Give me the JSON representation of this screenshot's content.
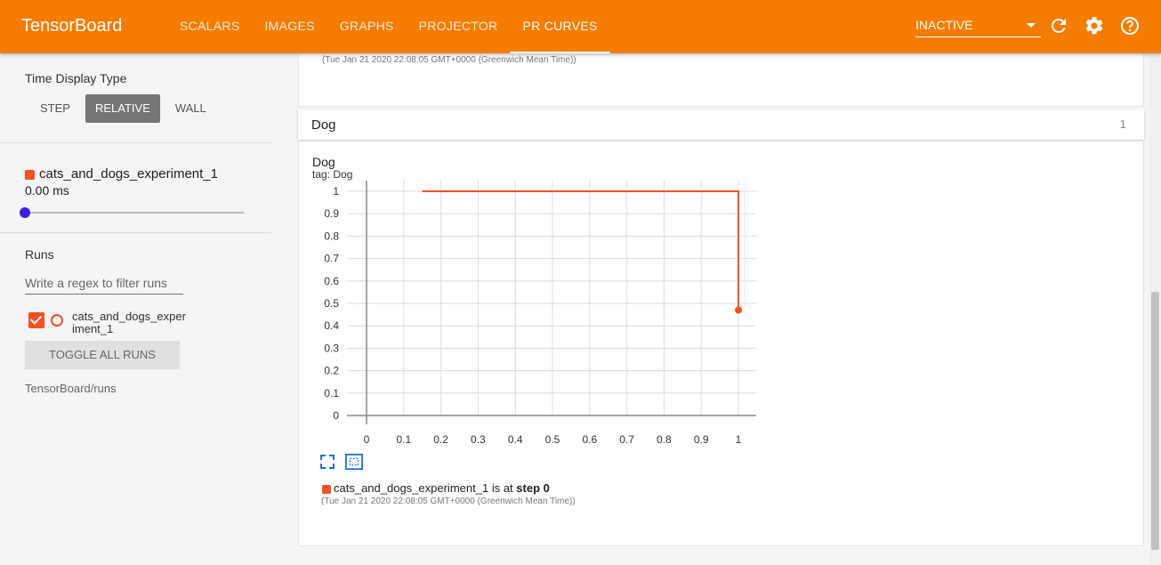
{
  "header": {
    "brand": "TensorBoard",
    "tabs": [
      {
        "label": "SCALARS",
        "active": false
      },
      {
        "label": "IMAGES",
        "active": false
      },
      {
        "label": "GRAPHS",
        "active": false
      },
      {
        "label": "PROJECTOR",
        "active": false
      },
      {
        "label": "PR CURVES",
        "active": true
      }
    ],
    "plugin_select": "INACTIVE",
    "icons": [
      "refresh-icon",
      "settings-icon",
      "help-icon"
    ],
    "color": "#f57c00"
  },
  "sidebar": {
    "time_display": {
      "title": "Time Display Type",
      "options": [
        "STEP",
        "RELATIVE",
        "WALL"
      ],
      "selected": "RELATIVE"
    },
    "step_slider": {
      "run": "cats_and_dogs_experiment_1",
      "value": "0.00 ms",
      "run_color": "#f4511e"
    },
    "runs": {
      "title": "Runs",
      "filter_placeholder": "Write a regex to filter runs",
      "items": [
        {
          "name": "cats_and_dogs_experiment_1",
          "checked": true
        }
      ],
      "toggle_all": "TOGGLE ALL RUNS",
      "logdir": "TensorBoard/runs"
    }
  },
  "main": {
    "prev_timestamp": "(Tue Jan 21 2020 22:08:05 GMT+0000 (Greenwich Mean Time))",
    "category": {
      "name": "Dog",
      "count": "1"
    },
    "card": {
      "title": "Dog",
      "tag": "tag: Dog",
      "legend": {
        "run": "cats_and_dogs_experiment_1",
        "text": "is at",
        "step": "step 0",
        "timestamp": "(Tue Jan 21 2020 22:08:05 GMT+0000 (Greenwich Mean Time))"
      }
    }
  },
  "chart_data": {
    "type": "line",
    "title": "Dog",
    "subtitle": "tag: Dog",
    "xlabel": "",
    "ylabel": "",
    "xlim": [
      0,
      1
    ],
    "ylim": [
      0,
      1
    ],
    "x_ticks": [
      "0",
      "0.1",
      "0.2",
      "0.3",
      "0.4",
      "0.5",
      "0.6",
      "0.7",
      "0.8",
      "0.9",
      "1"
    ],
    "y_ticks": [
      "0",
      "0.1",
      "0.2",
      "0.3",
      "0.4",
      "0.5",
      "0.6",
      "0.7",
      "0.8",
      "0.9",
      "1"
    ],
    "grid": true,
    "series": [
      {
        "name": "cats_and_dogs_experiment_1",
        "color": "#f4511e",
        "x": [
          0.15,
          1.0,
          1.0
        ],
        "y": [
          1.0,
          1.0,
          0.47
        ]
      }
    ]
  }
}
